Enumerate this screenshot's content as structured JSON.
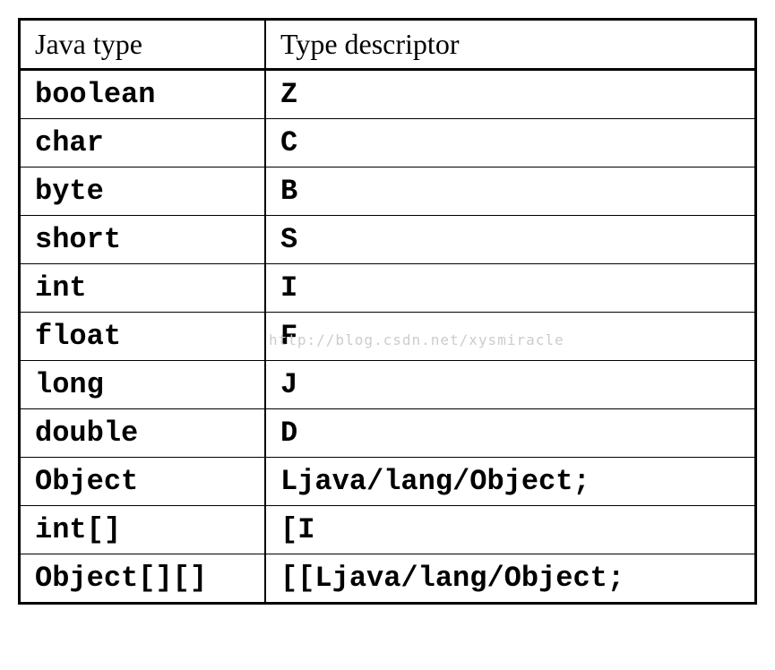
{
  "headers": {
    "col1": "Java type",
    "col2": "Type descriptor"
  },
  "rows": [
    {
      "java_type": "boolean",
      "descriptor": "Z"
    },
    {
      "java_type": "char",
      "descriptor": "C"
    },
    {
      "java_type": "byte",
      "descriptor": "B"
    },
    {
      "java_type": "short",
      "descriptor": "S"
    },
    {
      "java_type": "int",
      "descriptor": "I"
    },
    {
      "java_type": "float",
      "descriptor": "F"
    },
    {
      "java_type": "long",
      "descriptor": "J"
    },
    {
      "java_type": "double",
      "descriptor": "D"
    },
    {
      "java_type": "Object",
      "descriptor": "Ljava/lang/Object;"
    },
    {
      "java_type": "int[]",
      "descriptor": "[I"
    },
    {
      "java_type": "Object[][]",
      "descriptor": "[[Ljava/lang/Object;"
    }
  ],
  "watermark": "http://blog.csdn.net/xysmiracle"
}
